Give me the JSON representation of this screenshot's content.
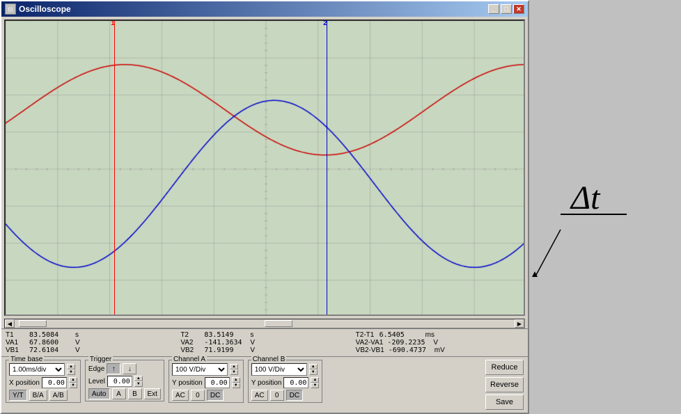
{
  "window": {
    "title": "Oscilloscope",
    "close_btn": "✕",
    "min_btn": "_",
    "max_btn": "□"
  },
  "measurements": {
    "col1": [
      {
        "label": "T1",
        "value": "83.5084",
        "unit": "s"
      },
      {
        "label": "VA1",
        "value": "67.8600",
        "unit": "V"
      },
      {
        "label": "VB1",
        "value": "72.6104",
        "unit": "V"
      }
    ],
    "col2": [
      {
        "label": "T2",
        "value": "83.5149",
        "unit": "s"
      },
      {
        "label": "VA2",
        "value": "-141.3634",
        "unit": "V"
      },
      {
        "label": "VB2",
        "value": "71.9199",
        "unit": "V"
      }
    ],
    "col3": [
      {
        "label": "T2-T1",
        "value": "6.5405",
        "unit": "ms"
      },
      {
        "label": "VA2-VA1",
        "value": "-209.2235",
        "unit": "V"
      },
      {
        "label": "VB2-VB1",
        "value": "-690.4737",
        "unit": "mV"
      }
    ]
  },
  "controls": {
    "time_base": {
      "label": "Time base",
      "value": "1.00ms/div",
      "x_position_label": "X position",
      "x_position_value": "0.00",
      "mode_buttons": [
        "Y/T",
        "B/A",
        "A/B"
      ]
    },
    "trigger": {
      "label": "Trigger",
      "edge_label": "Edge",
      "edge_buttons": [
        "↑",
        "↓"
      ],
      "level_label": "Level",
      "level_value": "0.00",
      "source_buttons": [
        "Auto",
        "A",
        "B",
        "Ext"
      ]
    },
    "channel_a": {
      "label": "Channel A",
      "value": "100 V/Div",
      "y_position_label": "Y position",
      "y_position_value": "0.00",
      "coupling_buttons": [
        "AC",
        "0",
        "DC"
      ]
    },
    "channel_b": {
      "label": "Channel B",
      "value": "100 V/Div",
      "y_position_label": "Y position",
      "y_position_value": "0.00",
      "coupling_buttons": [
        "AC",
        "0",
        "DC"
      ]
    }
  },
  "actions": {
    "reduce_label": "Reduce",
    "reverse_label": "Reverse",
    "save_label": "Save"
  },
  "colors": {
    "channel_a": "#cc0000",
    "channel_b": "#0000cc",
    "cursor1": "#cc0000",
    "cursor2": "#0000aa",
    "grid": "#aaaaaa",
    "screen_bg": "#c8d8c0"
  },
  "cursor1": {
    "label": "1",
    "position_pct": 21
  },
  "cursor2": {
    "label": "2",
    "position_pct": 62
  }
}
